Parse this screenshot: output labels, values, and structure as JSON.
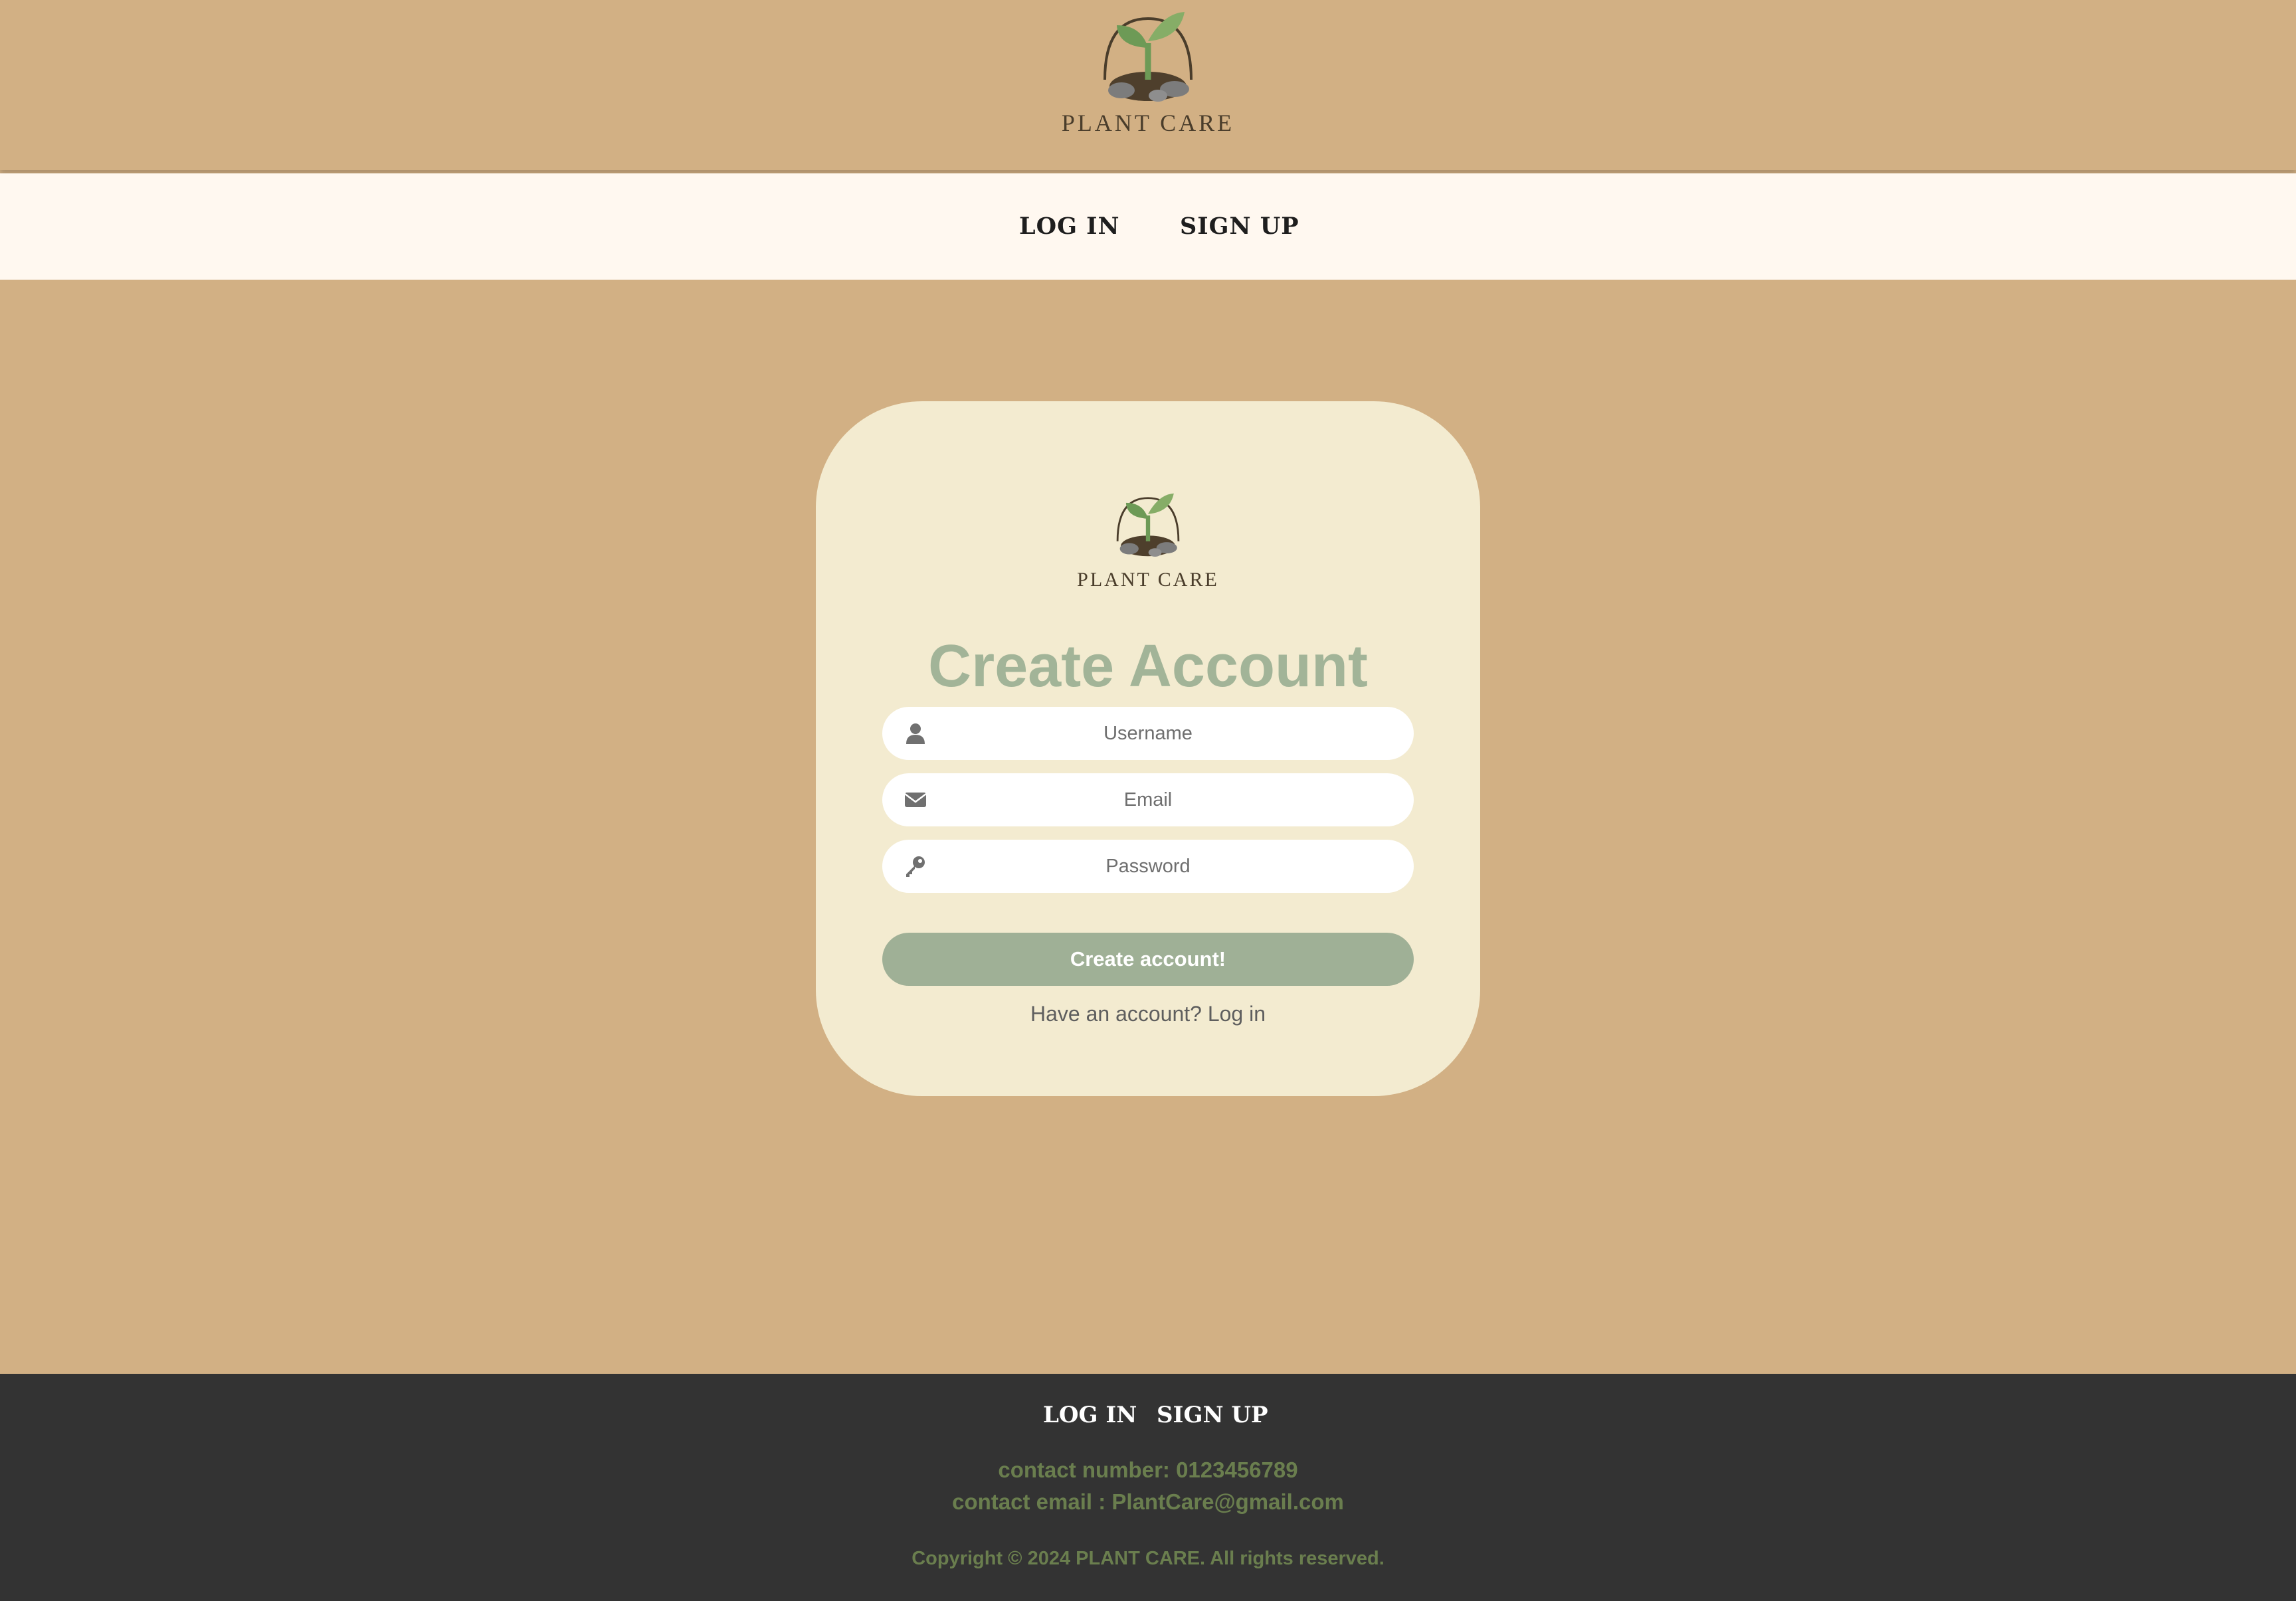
{
  "header": {
    "logo_text": "PLANT CARE"
  },
  "nav": {
    "login": "LOG IN",
    "signup": "SIGN UP"
  },
  "card": {
    "logo_text": "PLANT CARE",
    "title": "Create Account",
    "fields": {
      "username_placeholder": "Username",
      "email_placeholder": "Email",
      "password_placeholder": "Password"
    },
    "submit_label": "Create account!",
    "login_prompt": "Have an account? Log in"
  },
  "footer": {
    "login": "LOG IN",
    "signup": "SIGN UP",
    "contact_number": "contact number: 0123456789",
    "contact_email": "contact email : PlantCare@gmail.com",
    "copyright": "Copyright © 2024 PLANT CARE. All rights reserved."
  },
  "icons": {
    "username": "user-icon",
    "email": "envelope-icon",
    "password": "key-icon",
    "logo": "sprout-logo-icon"
  },
  "colors": {
    "background": "#d2b084",
    "navbar": "#fff8f0",
    "card": "#f3ebd0",
    "title": "#a2b498",
    "button": "#9fb096",
    "footer": "#333333",
    "footer_text": "#6a7e4e"
  }
}
